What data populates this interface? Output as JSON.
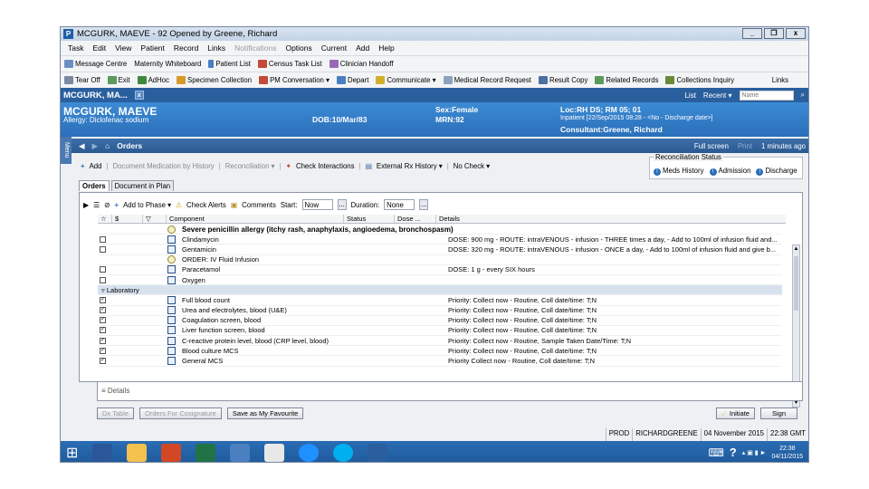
{
  "window": {
    "title": "MCGURK, MAEVE - 92 Opened by  Greene, Richard",
    "min": "_",
    "restore": "❐",
    "close": "x"
  },
  "menu": [
    "Task",
    "Edit",
    "View",
    "Patient",
    "Record",
    "Links",
    "Notifications",
    "Options",
    "Current",
    "Add",
    "Help"
  ],
  "toolbar1": [
    "Message Centre",
    "Maternity Whiteboard",
    "Patient List",
    "Census Task List",
    "Clinician Handoff"
  ],
  "toolbar2": [
    "Tear Off",
    "Exit",
    "AdHoc",
    "Specimen Collection",
    "PM Conversation ▾",
    "Depart",
    "Communicate ▾",
    "Medical Record Request",
    "Result Copy",
    "Related Records",
    "Collections Inquiry",
    "Links"
  ],
  "patient_tab": {
    "label": "MCGURK, MA...",
    "list": "List",
    "recent": "Recent ▾",
    "name_placeholder": "Name"
  },
  "banner": {
    "name": "MCGURK, MAEVE",
    "allergy": "Allergy: Diclofenac sodium",
    "dob": "DOB:10/Mar/83",
    "sex": "Sex:Female",
    "mrn": "MRN:92",
    "loc": "Loc:RH DS; RM 05; 01",
    "inpatient": "Inpatient [22/Sep/2015 08:28 - <No - Discharge date>]",
    "consultant": "Consultant:Greene, Richard"
  },
  "side_menu": "Menu",
  "nav": {
    "title": "Orders",
    "fullscreen": "Full screen",
    "print": "Print",
    "ago": "1 minutes ago"
  },
  "actions": {
    "add": "Add",
    "doc_med": "Document Medication by History",
    "reconciliation": "Reconciliation ▾",
    "check": "Check Interactions",
    "external": "External Rx History ▾",
    "nocheck": "No Check ▾"
  },
  "recon": {
    "legend": "Reconciliation Status",
    "meds": "Meds History",
    "admission": "Admission",
    "discharge": "Discharge"
  },
  "tabs": [
    "Orders",
    "Document in Plan"
  ],
  "phase": {
    "add_phase": "Add to Phase ▾",
    "check_alerts": "Check Alerts",
    "comments": "Comments",
    "start_label": "Start:",
    "start_value": "Now",
    "duration_label": "Duration:",
    "duration_value": "None",
    "dots": "..."
  },
  "columns": {
    "flag": "☆",
    "dollar": "$",
    "filter": "▽",
    "component": "Component",
    "status": "Status",
    "dose": "Dose ...",
    "details": "Details"
  },
  "rows": [
    {
      "type": "alert",
      "component": "Severe penicillin allergy (itchy rash, anaphylaxis, angioedema, bronchospasm)",
      "details": "",
      "check": ""
    },
    {
      "type": "order",
      "component": "Clindamycin",
      "details": "DOSE: 900 mg - ROUTE: intraVENOUS - infusion - THREE times a day, - Add to 100ml of infusion fluid and...",
      "check": ""
    },
    {
      "type": "order",
      "component": "Gentamicin",
      "details": "DOSE: 320 mg - ROUTE: intraVENOUS - infusion - ONCE a day, - Add to 100ml of infusion fluid and give b...",
      "check": ""
    },
    {
      "type": "note",
      "component": "ORDER: IV Fluid Infusion",
      "details": "",
      "check": ""
    },
    {
      "type": "order",
      "component": "Paracetamol",
      "details": "DOSE: 1 g - every SIX hours",
      "check": ""
    },
    {
      "type": "order",
      "component": "Oxygen",
      "details": "",
      "check": ""
    },
    {
      "type": "section",
      "component": "▿  Laboratory",
      "details": "",
      "check": ""
    },
    {
      "type": "order",
      "component": "Full blood count",
      "details": "Priority: Collect now - Routine, Coll date/time: T;N",
      "check": "✓"
    },
    {
      "type": "order",
      "component": "Urea and electrolytes, blood (U&E)",
      "details": "Priority: Collect now - Routine, Coll date/time: T;N",
      "check": "✓"
    },
    {
      "type": "order",
      "component": "Coagulation screen, blood",
      "details": "Priority: Collect now - Routine, Coll date/time: T;N",
      "check": "✓"
    },
    {
      "type": "order",
      "component": "Liver function screen, blood",
      "details": "Priority: Collect now - Routine, Coll date/time: T;N",
      "check": "✓"
    },
    {
      "type": "order",
      "component": "C-reactive protein level, blood (CRP level, blood)",
      "details": "Priority: Collect now - Routine, Sample Taken Date/Time: T;N",
      "check": "✓"
    },
    {
      "type": "order",
      "component": "Blood culture MCS",
      "details": "Priority: Collect now - Routine, Coll date/time: T;N",
      "check": "✓"
    },
    {
      "type": "order",
      "component": "General MCS",
      "details": "Priority Collect now - Routine, Coll date/time: T;N",
      "check": "✓"
    }
  ],
  "details_label": "≡  Details",
  "buttons": {
    "dx": "Dx Table",
    "cosign": "Orders For Cosignature",
    "fav": "Save as My Favourite",
    "initiate": "Initiate",
    "sign": "Sign"
  },
  "status": {
    "env": "PROD",
    "user": "RICHARDGREENE",
    "date": "04 November 2015",
    "time": "22:38 GMT"
  },
  "taskbar": {
    "time": "22:38",
    "date": "04/11/2015"
  }
}
